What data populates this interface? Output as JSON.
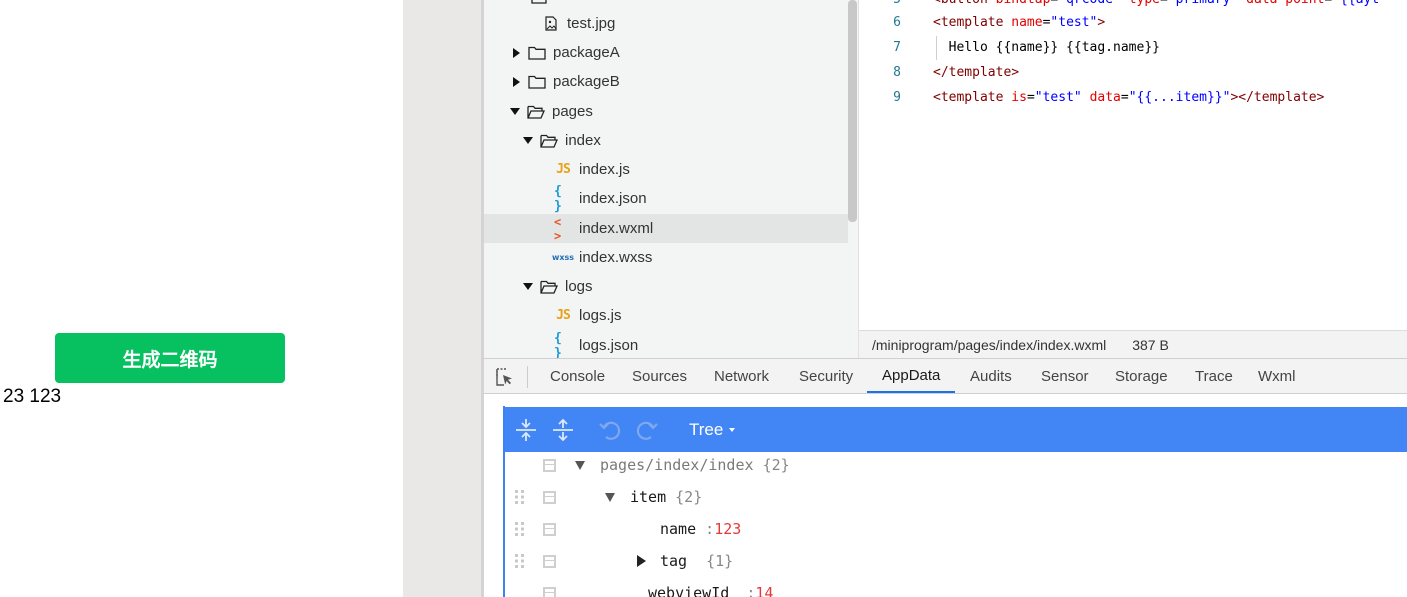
{
  "simulator": {
    "button_label": "生成二维码",
    "output_text": "23 123"
  },
  "file_tree": {
    "items": [
      {
        "label": "test.jpg",
        "icon": "image-file-icon"
      },
      {
        "label": "packageA",
        "icon": "folder-icon",
        "state": "collapsed"
      },
      {
        "label": "packageB",
        "icon": "folder-icon",
        "state": "collapsed"
      },
      {
        "label": "pages",
        "icon": "folder-open-icon",
        "state": "expanded"
      },
      {
        "label": "index",
        "icon": "folder-open-icon",
        "state": "expanded"
      },
      {
        "label": "index.js",
        "icon": "js-file-icon"
      },
      {
        "label": "index.json",
        "icon": "json-file-icon"
      },
      {
        "label": "index.wxml",
        "icon": "wxml-file-icon",
        "selected": true
      },
      {
        "label": "index.wxss",
        "icon": "wxss-file-icon"
      },
      {
        "label": "logs",
        "icon": "folder-open-icon",
        "state": "expanded"
      },
      {
        "label": "logs.js",
        "icon": "js-file-icon"
      },
      {
        "label": "logs.json",
        "icon": "json-file-icon"
      }
    ],
    "icon_glyphs": {
      "js": "JS",
      "json": "{ }",
      "wxml": "< >",
      "wxss": "wxss"
    }
  },
  "editor": {
    "lines": [
      {
        "num": "5",
        "parts": [
          [
            "tag",
            "<button "
          ],
          [
            "attr",
            "bindtap"
          ],
          [
            "txt",
            "="
          ],
          [
            "str",
            "\"qrcode\" "
          ],
          [
            "attr",
            "type"
          ],
          [
            "txt",
            "="
          ],
          [
            "str",
            "\"primary\" "
          ],
          [
            "attr",
            "data-point"
          ],
          [
            "txt",
            "="
          ],
          [
            "str",
            "\"{{ayt"
          ]
        ]
      },
      {
        "num": "6",
        "parts": [
          [
            "tag",
            "<template "
          ],
          [
            "attr",
            "name"
          ],
          [
            "txt",
            "="
          ],
          [
            "str",
            "\"test\""
          ],
          [
            "tag",
            ">"
          ]
        ]
      },
      {
        "num": "7",
        "parts": [
          [
            "txt",
            "  Hello {{name}} {{tag.name}}"
          ]
        ]
      },
      {
        "num": "8",
        "parts": [
          [
            "tag",
            "</template>"
          ]
        ]
      },
      {
        "num": "9",
        "parts": [
          [
            "tag",
            "<template "
          ],
          [
            "attr",
            "is"
          ],
          [
            "txt",
            "="
          ],
          [
            "str",
            "\"test\" "
          ],
          [
            "attr",
            "data"
          ],
          [
            "txt",
            "="
          ],
          [
            "str",
            "\"{{...item}}\""
          ],
          [
            "tag",
            "></template>"
          ]
        ]
      }
    ],
    "status_path": "/miniprogram/pages/index/index.wxml",
    "status_size": "387 B"
  },
  "devtools": {
    "tabs": [
      "Console",
      "Sources",
      "Network",
      "Security",
      "AppData",
      "Audits",
      "Sensor",
      "Storage",
      "Trace",
      "Wxml"
    ],
    "active_tab": "AppData",
    "toolbar": {
      "view_mode": "Tree"
    },
    "tree": {
      "root": {
        "key": "pages/index/index",
        "count": "{2}"
      },
      "item": {
        "key": "item",
        "count": "{2}"
      },
      "name": {
        "key": "name",
        "value": "123"
      },
      "tag": {
        "key": "tag",
        "count": "{1}"
      },
      "webviewId": {
        "key": "webviewId",
        "value": "14"
      }
    }
  },
  "colors": {
    "primary_button": "#07c160",
    "accent_blue": "#4285f4",
    "active_tab_underline": "#1a73e8"
  }
}
